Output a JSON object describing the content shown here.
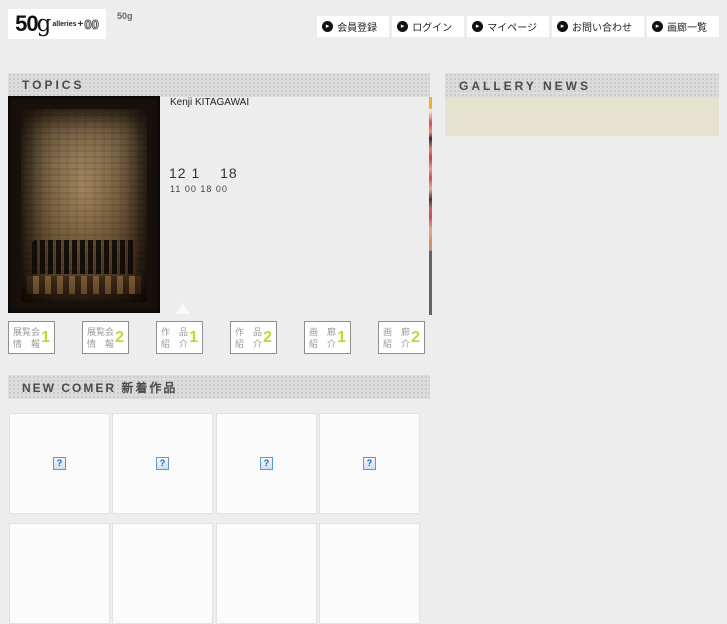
{
  "colors": {
    "page_bg": "#ededed",
    "hatch_bg": "#dcdcdc",
    "beige_panel": "#e5e3cf",
    "button_number": "#c8d433",
    "broken_icon_blue": "#1c63b7"
  },
  "header": {
    "logo": {
      "num": "50",
      "g": "g",
      "suffix": "alleries",
      "plus": "+",
      "zeros": "00"
    },
    "tagline": "50g",
    "nav_bullet": "▸",
    "nav": [
      {
        "label": "会員登録"
      },
      {
        "label": "ログイン"
      },
      {
        "label": "マイページ"
      },
      {
        "label": "お問い合わせ"
      },
      {
        "label": "画廊一覧"
      }
    ]
  },
  "topics": {
    "title": "TOPICS",
    "artist": "Kenji KITAGAWAI",
    "date_line": "12 1　 18",
    "time_line": "11 00 18 00",
    "buttons": [
      {
        "line1": "展覧会",
        "line2": "情　報",
        "num": "1"
      },
      {
        "line1": "展覧会",
        "line2": "情　報",
        "num": "2"
      },
      {
        "line1": "作　品",
        "line2": "紹　介",
        "num": "1"
      },
      {
        "line1": "作　品",
        "line2": "紹　介",
        "num": "2"
      },
      {
        "line1": "画　廊",
        "line2": "紹　介",
        "num": "1"
      },
      {
        "line1": "画　廊",
        "line2": "紹　介",
        "num": "2"
      }
    ]
  },
  "gallery_news": {
    "title": "GALLERY NEWS"
  },
  "newcomer": {
    "title": "NEW COMER 新着作品",
    "broken_image_glyph": "?"
  }
}
